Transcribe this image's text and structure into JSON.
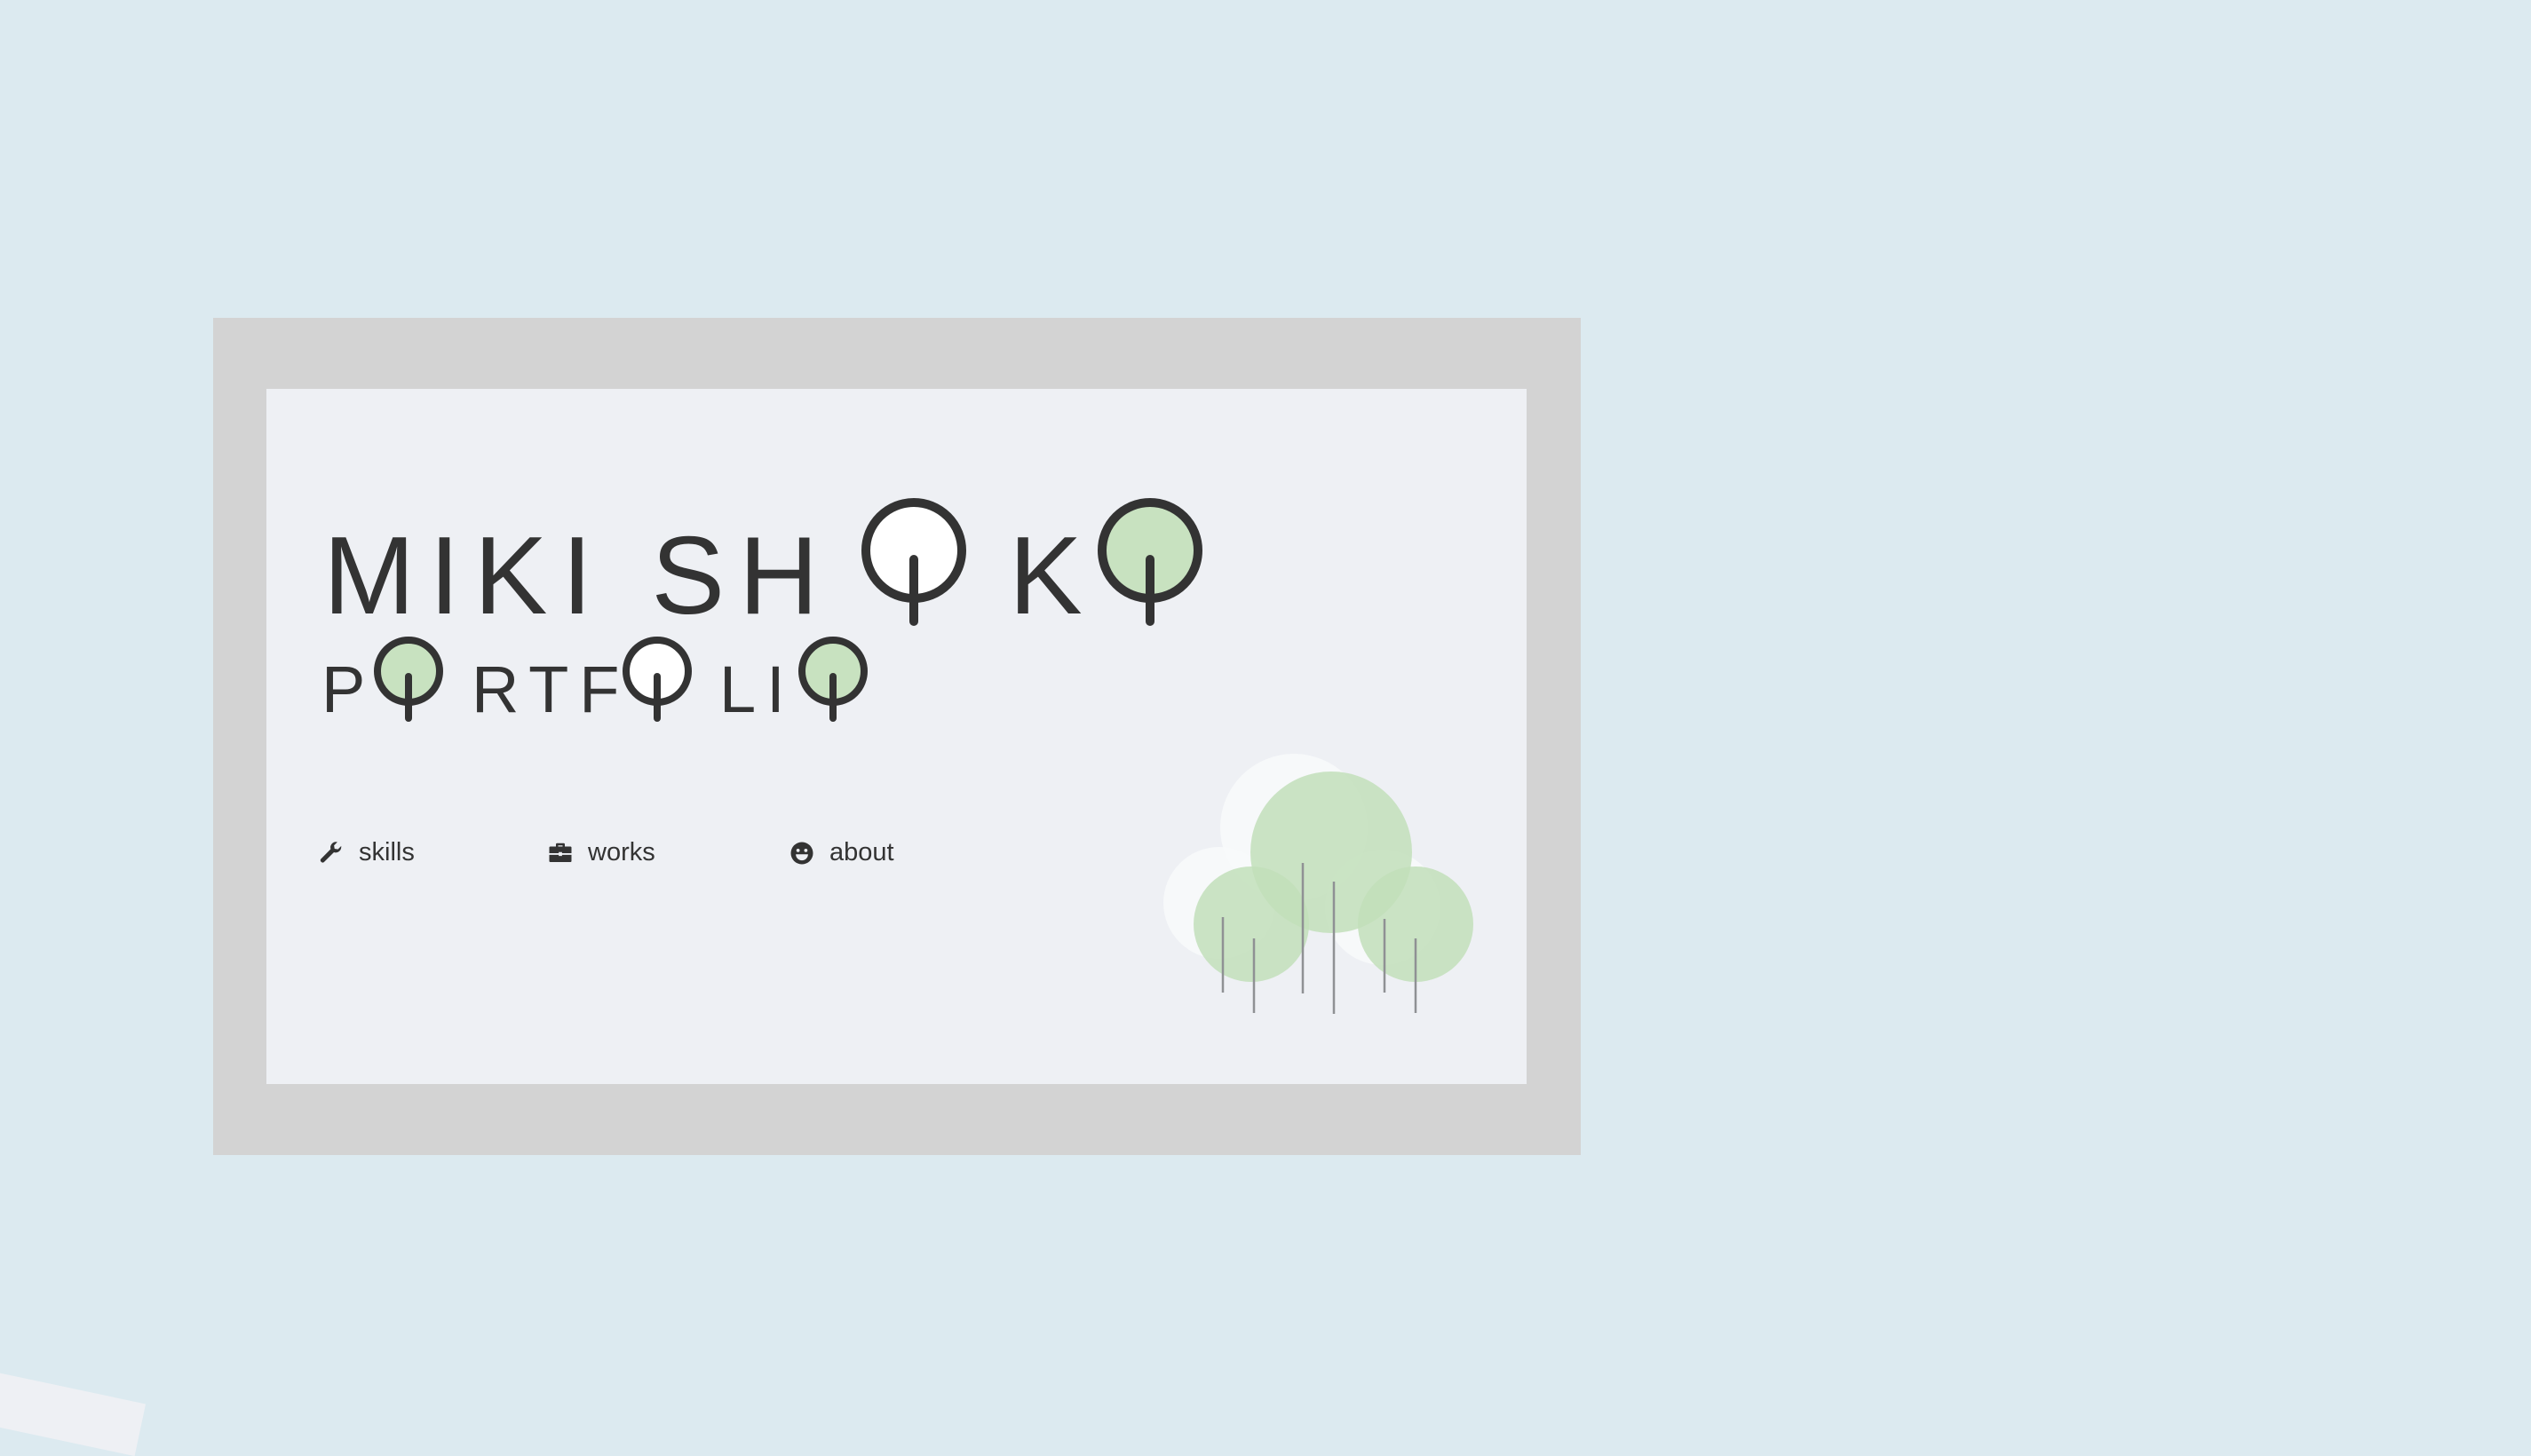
{
  "logo": {
    "line1_a": "MIKI SH",
    "line1_b": "K",
    "line2_a": "P",
    "line2_b": "RTF",
    "line2_c": "LI",
    "full_text": "MIKI SHOKO PORTFOLIO"
  },
  "nav": [
    {
      "label": "skills",
      "icon": "wrench-icon"
    },
    {
      "label": "works",
      "icon": "briefcase-icon"
    },
    {
      "label": "about",
      "icon": "smile-icon"
    }
  ],
  "colors": {
    "background": "#dceaf0",
    "frame": "#d3d3d3",
    "paper": "#eef0f4",
    "tree_green": "#c8e2c0",
    "ink": "#333333"
  }
}
